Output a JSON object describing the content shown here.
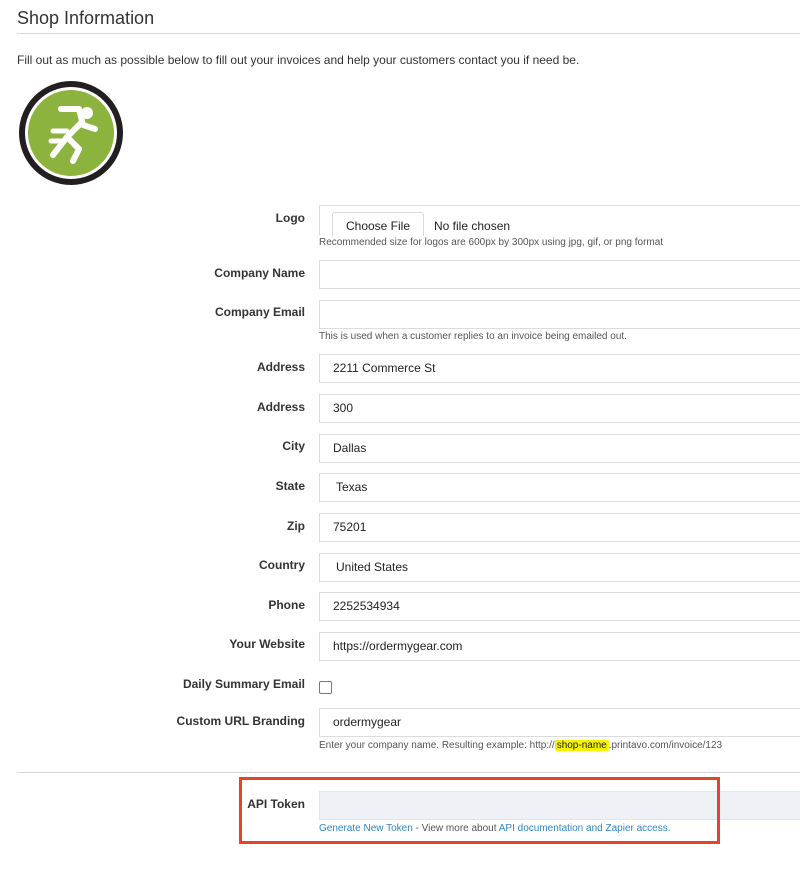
{
  "header": {
    "title": "Shop Information",
    "intro": "Fill out as much as possible below to fill out your invoices and help your customers contact you if need be."
  },
  "logo": {
    "alt_icon": "runner-logo-icon",
    "label": "Logo",
    "choose_button": "Choose File",
    "file_status": "No file chosen",
    "help": "Recommended size for logos are 600px by 300px using jpg, gif, or png format"
  },
  "fields": {
    "company_name": {
      "label": "Company Name",
      "value": ""
    },
    "company_email": {
      "label": "Company Email",
      "value": "",
      "help": "This is used when a customer replies to an invoice being emailed out."
    },
    "address1": {
      "label": "Address",
      "value": "2211 Commerce St"
    },
    "address2": {
      "label": "Address",
      "value": "300"
    },
    "city": {
      "label": "City",
      "value": "Dallas"
    },
    "state": {
      "label": "State",
      "value": "Texas"
    },
    "zip": {
      "label": "Zip",
      "value": "75201"
    },
    "country": {
      "label": "Country",
      "value": "United States"
    },
    "phone": {
      "label": "Phone",
      "value": "2252534934"
    },
    "website": {
      "label": "Your Website",
      "value": "https://ordermygear.com"
    },
    "daily_summary": {
      "label": "Daily Summary Email",
      "checked": false
    },
    "custom_url": {
      "label": "Custom URL Branding",
      "value": "ordermygear",
      "help_prefix": "Enter your company name. Resulting example: http://",
      "help_highlight": "shop-name",
      "help_suffix": ".printavo.com/invoice/123"
    }
  },
  "api": {
    "label": "API Token",
    "value": "",
    "generate_link": "Generate New Token",
    "mid_text": " - View more about ",
    "docs_link": "API documentation and Zapier access."
  },
  "colors": {
    "logo_green": "#8db33f",
    "logo_ring": "#231f20",
    "link": "#2e86c9",
    "highlight": "#f6f300",
    "annotation_box": "#e5432a"
  }
}
